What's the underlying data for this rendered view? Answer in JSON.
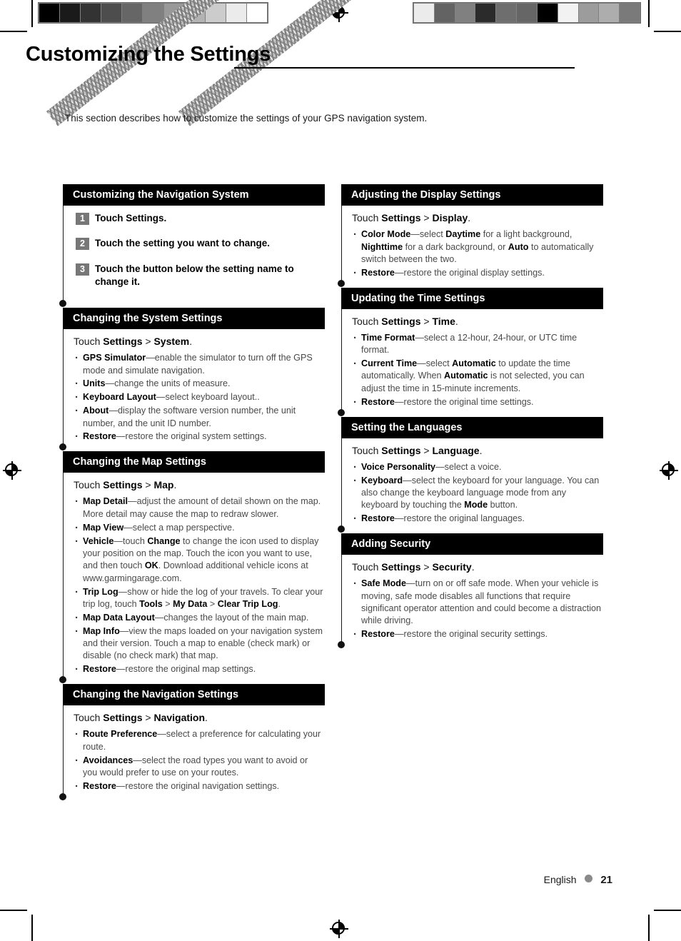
{
  "document": {
    "title": "Customizing the Settings",
    "intro": "This section describes how to customize the settings of your GPS navigation system."
  },
  "footer": {
    "language": "English",
    "page_number": "21",
    "dot_color": "#8a8a8a"
  },
  "colors": {
    "section_header_bg": "#000000",
    "section_header_text": "#ffffff",
    "step_badge_bg": "#777777",
    "body_text": "#4a4a4a",
    "term_text": "#000000"
  },
  "print_marks": {
    "gray_wedge": [
      "#000000",
      "#1a1a1a",
      "#333333",
      "#4d4d4d",
      "#666666",
      "#808080",
      "#999999",
      "#b3b3b3",
      "#cccccc",
      "#ebebeb",
      "#ffffff"
    ],
    "color_bar": [
      "#ebebeb",
      "#636363",
      "#808080",
      "#2b2b2b",
      "#6e6e6e",
      "#666666",
      "#000000",
      "#f2f2f2",
      "#9c9c9c",
      "#adadad",
      "#7a7a7a"
    ],
    "registration_icon": "registration-target-icon"
  },
  "left_column": [
    {
      "heading": "Customizing the Navigation System",
      "type": "steps",
      "steps": [
        {
          "num": "1",
          "text": "Touch Settings."
        },
        {
          "num": "2",
          "text": "Touch the setting you want to change."
        },
        {
          "num": "3",
          "text": "Touch the button below the setting name to change it."
        }
      ]
    },
    {
      "heading": "Changing the System Settings",
      "type": "bullets",
      "touch_prefix": "Touch ",
      "touch_path": [
        "Settings",
        "System"
      ],
      "bullets": [
        {
          "term": "GPS Simulator",
          "desc": "—enable the simulator to turn off the GPS mode and simulate navigation."
        },
        {
          "term": "Units",
          "desc": "—change the units of measure."
        },
        {
          "term": "Keyboard Layout",
          "desc": "—select keyboard layout.."
        },
        {
          "term": "About",
          "desc": "—display the software version number, the unit number, and the unit ID number."
        },
        {
          "term": "Restore",
          "desc": "—restore the original system settings."
        }
      ]
    },
    {
      "heading": "Changing the Map Settings",
      "type": "bullets",
      "touch_prefix": "Touch ",
      "touch_path": [
        "Settings",
        "Map"
      ],
      "bullets": [
        {
          "term": "Map Detail",
          "desc": "—adjust the amount of detail shown on the map. More detail may cause the map to redraw slower."
        },
        {
          "term": "Map View",
          "desc": "—select a map perspective."
        },
        {
          "term": "Vehicle",
          "desc": "—touch Change to change the icon used to display your position on the map. Touch the icon you want to use, and then touch OK. Download additional vehicle icons at www.garmingarage.com."
        },
        {
          "term": "Trip Log",
          "desc": "—show or hide the log of your travels. To clear your trip log, touch Tools > My Data > Clear Trip Log."
        },
        {
          "term": "Map Data Layout",
          "desc": "—changes the layout of the main map."
        },
        {
          "term": "Map Info",
          "desc": "—view the maps loaded on your navigation system and their version. Touch a map to enable (check mark) or disable (no check mark) that map."
        },
        {
          "term": "Restore",
          "desc": "—restore the original map settings."
        }
      ]
    },
    {
      "heading": "Changing the Navigation Settings",
      "type": "bullets",
      "touch_prefix": "Touch ",
      "touch_path": [
        "Settings",
        "Navigation"
      ],
      "bullets": [
        {
          "term": "Route Preference",
          "desc": "—select a preference for calculating your route."
        },
        {
          "term": "Avoidances",
          "desc": "—select the road types you want to avoid or you would prefer to use on your routes."
        },
        {
          "term": "Restore",
          "desc": "—restore the original navigation settings."
        }
      ]
    }
  ],
  "right_column": [
    {
      "heading": "Adjusting the Display Settings",
      "type": "bullets",
      "touch_prefix": "Touch ",
      "touch_path": [
        "Settings",
        "Display"
      ],
      "bullets": [
        {
          "term": "Color Mode",
          "desc": "—select Daytime for a light background, Nighttime for a dark background, or Auto to automatically switch between the two."
        },
        {
          "term": "Restore",
          "desc": "—restore the original display settings."
        }
      ]
    },
    {
      "heading": "Updating the Time Settings",
      "type": "bullets",
      "touch_prefix": "Touch ",
      "touch_path": [
        "Settings",
        "Time"
      ],
      "bullets": [
        {
          "term": "Time Format",
          "desc": "—select a 12-hour, 24-hour, or UTC time format."
        },
        {
          "term": "Current Time",
          "desc": "—select Automatic to update the time automatically. When Automatic is not selected, you can adjust the time in 15-minute increments."
        },
        {
          "term": "Restore",
          "desc": "—restore the original time settings."
        }
      ]
    },
    {
      "heading": "Setting the Languages",
      "type": "bullets",
      "touch_prefix": "Touch ",
      "touch_path": [
        "Settings",
        "Language"
      ],
      "bullets": [
        {
          "term": "Voice Personality",
          "desc": "—select a voice."
        },
        {
          "term": "Keyboard",
          "desc": "—select the keyboard for your language. You can also change the keyboard language mode from any keyboard by touching the Mode button."
        },
        {
          "term": "Restore",
          "desc": "—restore the original languages."
        }
      ]
    },
    {
      "heading": "Adding Security",
      "type": "bullets",
      "touch_prefix": "Touch ",
      "touch_path": [
        "Settings",
        "Security"
      ],
      "bullets": [
        {
          "term": "Safe Mode",
          "desc": "—turn on or off safe mode. When your vehicle is moving, safe mode disables all functions that require significant operator attention and could become a distraction while driving."
        },
        {
          "term": "Restore",
          "desc": "—restore the original security settings."
        }
      ]
    }
  ],
  "bold_terms_inline": [
    "Change",
    "OK",
    "Tools",
    "My Data",
    "Clear Trip Log",
    "Daytime",
    "Nighttime",
    "Auto",
    "Automatic",
    "Mode"
  ]
}
